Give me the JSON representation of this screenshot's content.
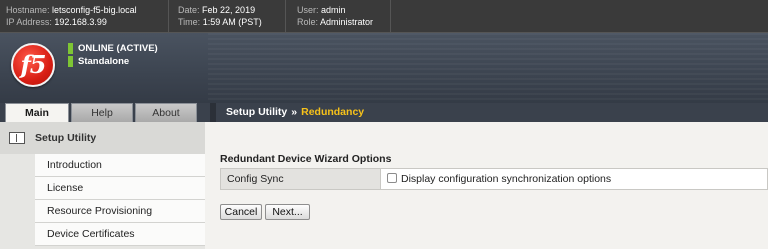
{
  "header": {
    "hostname_label": "Hostname:",
    "hostname": "letsconfig-f5-big.local",
    "ip_label": "IP Address:",
    "ip": "192.168.3.99",
    "date_label": "Date:",
    "date": "Feb 22, 2019",
    "time_label": "Time:",
    "time": "1:59 AM (PST)",
    "user_label": "User:",
    "user": "admin",
    "role_label": "Role:",
    "role": "Administrator"
  },
  "banner": {
    "logo_text": "f5",
    "status_primary": "ONLINE (ACTIVE)",
    "status_secondary": "Standalone",
    "status_color": "#7ec534"
  },
  "tabs": [
    {
      "label": "Main",
      "active": true
    },
    {
      "label": "Help",
      "active": false
    },
    {
      "label": "About",
      "active": false
    }
  ],
  "breadcrumb": {
    "parent": "Setup Utility",
    "separator": "»",
    "current": "Redundancy",
    "current_color": "#f7c21a"
  },
  "sidebar": {
    "section_title": "Setup Utility",
    "section_icon": "setup-utility-icon",
    "items": [
      {
        "label": "Introduction"
      },
      {
        "label": "License"
      },
      {
        "label": "Resource Provisioning"
      },
      {
        "label": "Device Certificates"
      }
    ]
  },
  "main": {
    "section_title": "Redundant Device Wizard Options",
    "options": [
      {
        "label": "Config Sync",
        "checkbox_label": "Display configuration synchronization options",
        "checked": false
      }
    ],
    "buttons": {
      "cancel": "Cancel",
      "next": "Next..."
    }
  }
}
